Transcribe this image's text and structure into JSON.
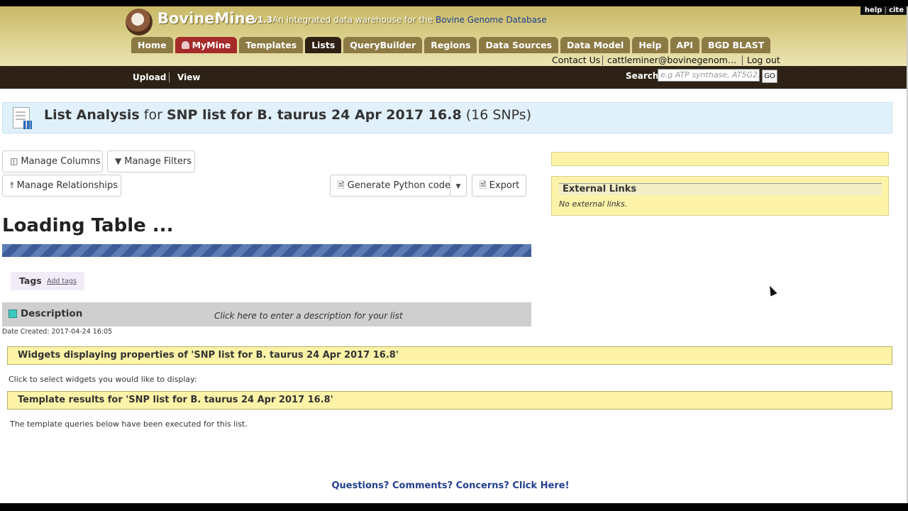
{
  "header": {
    "brand": "BovineMine",
    "version": "v1.3",
    "tagline_prefix": "An integrated data warehouse for the",
    "tagline_link": "Bovine Genome Database",
    "corner_help": "help",
    "corner_cite": "cite"
  },
  "tabs": [
    {
      "label": "Home"
    },
    {
      "label": "MyMine"
    },
    {
      "label": "Templates"
    },
    {
      "label": "Lists"
    },
    {
      "label": "QueryBuilder"
    },
    {
      "label": "Regions"
    },
    {
      "label": "Data Sources"
    },
    {
      "label": "Data Model"
    },
    {
      "label": "Help"
    },
    {
      "label": "API"
    },
    {
      "label": "BGD BLAST"
    }
  ],
  "userbar": {
    "contact": "Contact Us",
    "user": "cattleminer@bovinegenome....",
    "logout": "Log out"
  },
  "subnav": {
    "upload": "Upload",
    "view": "View",
    "search_label": "Search:",
    "search_placeholder": "e.g ATP synthase, AT5G2...",
    "go": "GO"
  },
  "banner": {
    "title": "List Analysis",
    "for": "for",
    "list_name": "SNP list for B. taurus 24 Apr 2017 16.8",
    "count": "(16 SNPs)"
  },
  "toolbar": {
    "manage_columns": "Manage Columns",
    "manage_filters": "Manage Filters",
    "manage_relationships": "Manage Relationships",
    "generate_code": "Generate Python code",
    "export": "Export"
  },
  "table": {
    "loading": "Loading Table ...",
    "progress_percent": 100
  },
  "tags": {
    "label": "Tags",
    "add": "Add tags"
  },
  "description": {
    "label": "Description",
    "hint": "Click here to enter a description for your list",
    "date_created": "Date Created: 2017-04-24 16:05"
  },
  "sidebar": {
    "external_links_title": "External Links",
    "external_links_empty": "No external links."
  },
  "widgets": {
    "title": "Widgets displaying properties of 'SNP list for B. taurus 24 Apr 2017 16.8'",
    "note": "Click to select widgets you would like to display:"
  },
  "templates": {
    "title": "Template results for 'SNP list for B. taurus 24 Apr 2017 16.8'",
    "note": "The template queries below have been executed for this list."
  },
  "footer": {
    "link": "Questions? Comments? Concerns? Click Here!"
  },
  "colors": {
    "header_gold": "#d8cd86",
    "subnav_brown": "#2e2216",
    "tab_brown": "#8c7a44",
    "mymine_red": "#a52a2a",
    "banner_blue": "#e1f1fb",
    "progress_blue": "#3c5d99",
    "panel_yellow": "#fcf3a8",
    "link_blue": "#23408e"
  }
}
